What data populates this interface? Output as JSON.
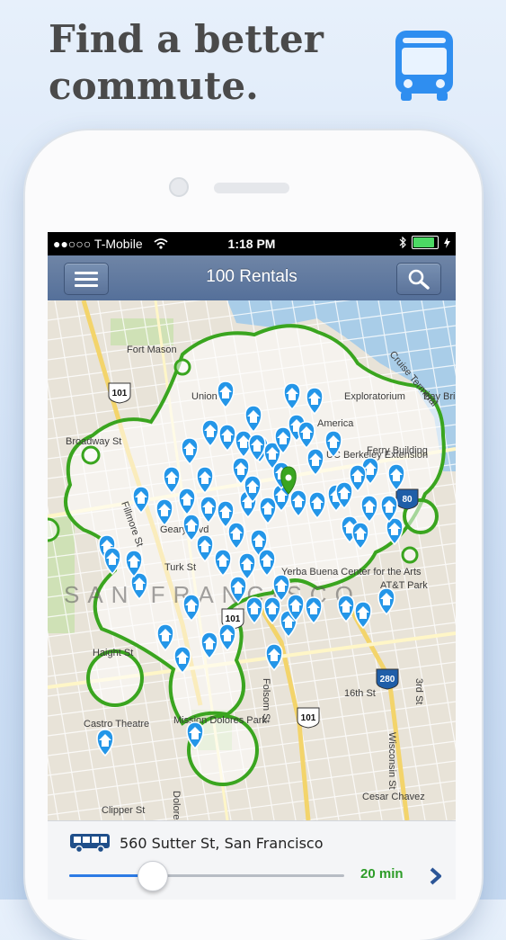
{
  "headline": {
    "line1": "Find a better",
    "line2": "commute."
  },
  "badge": {
    "icon": "bus-icon",
    "color": "#2f8ef0"
  },
  "status_bar": {
    "carrier": "●●○○○ T-Mobile",
    "time": "1:18 PM",
    "battery_level": 0.9,
    "icons": [
      "wifi-icon",
      "bluetooth-icon",
      "battery-icon",
      "charging-icon"
    ]
  },
  "nav_bar": {
    "title": "100 Rentals",
    "menu_icon": "hamburger-menu-icon",
    "search_icon": "search-icon"
  },
  "map": {
    "city_label": "SAN FRANCISCO",
    "highway_shields": [
      "101",
      "101",
      "101",
      "280",
      "80"
    ],
    "street_labels": [
      "Fort Mason",
      "Union St",
      "Broadway St",
      "Fillmore St",
      "Geary Blvd",
      "Turk St",
      "Haight St",
      "Castro Theatre",
      "Mission Dolores Park",
      "Dolores St",
      "Folsom St",
      "16th St",
      "Clipper St",
      "Cesar Chavez",
      "Wisconsin St",
      "3rd St",
      "Bay Bri",
      "Exploratorium",
      "UC Berkeley Extension",
      "Yerba Buena Center for the Arts",
      "AT&T Park",
      "Ferry Building",
      "America",
      "Cruise Terminal"
    ],
    "pin_icon": "rental-pin-icon",
    "selected_pin_icon": "selected-location-pin-icon",
    "coverage_color": "#3aa51f",
    "pin_color": "#2496e8"
  },
  "commute": {
    "mode_icon": "bus-icon",
    "address": "560 Sutter St, San Francisco",
    "minutes_label": "20 min",
    "slider_fraction": 0.3,
    "next_icon": "chevron-right-icon",
    "minutes_color": "#2d9c28"
  }
}
